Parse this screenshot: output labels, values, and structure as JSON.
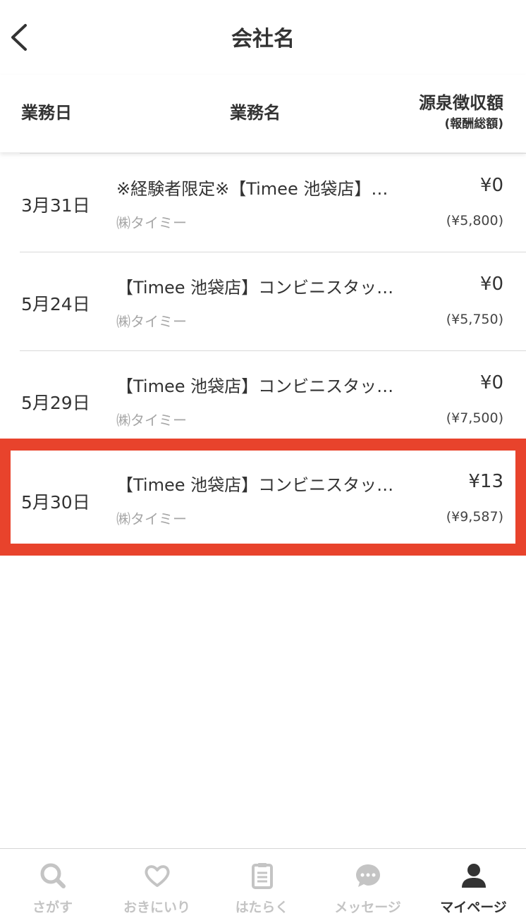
{
  "header": {
    "title": "会社名"
  },
  "columns": {
    "date": "業務日",
    "name": "業務名",
    "amount": "源泉徴収額",
    "amount_sub": "(報酬総額)"
  },
  "rows": [
    {
      "date": "3月31日",
      "title": "※経験者限定※【Timee 池袋店】…",
      "company": "㈱タイミー",
      "amount": "¥0",
      "gross": "(¥5,800)"
    },
    {
      "date": "5月24日",
      "title": "【Timee 池袋店】コンビニスタッ…",
      "company": "㈱タイミー",
      "amount": "¥0",
      "gross": "(¥5,750)"
    },
    {
      "date": "5月29日",
      "title": "【Timee 池袋店】コンビニスタッ…",
      "company": "㈱タイミー",
      "amount": "¥0",
      "gross": "(¥7,500)"
    },
    {
      "date": "5月30日",
      "title": "【Timee 池袋店】コンビニスタッ…",
      "company": "㈱タイミー",
      "amount": "¥13",
      "gross": "(¥9,587)"
    }
  ],
  "tabbar": {
    "items": [
      {
        "label": "さがす",
        "icon": "search-icon"
      },
      {
        "label": "おきにいり",
        "icon": "heart-icon"
      },
      {
        "label": "はたらく",
        "icon": "clipboard-icon"
      },
      {
        "label": "メッセージ",
        "icon": "chat-icon"
      },
      {
        "label": "マイページ",
        "icon": "person-icon"
      }
    ],
    "active_index": 4
  },
  "colors": {
    "highlight": "#e8432c",
    "inactive_tab": "#c4c4c4",
    "text": "#333333"
  }
}
